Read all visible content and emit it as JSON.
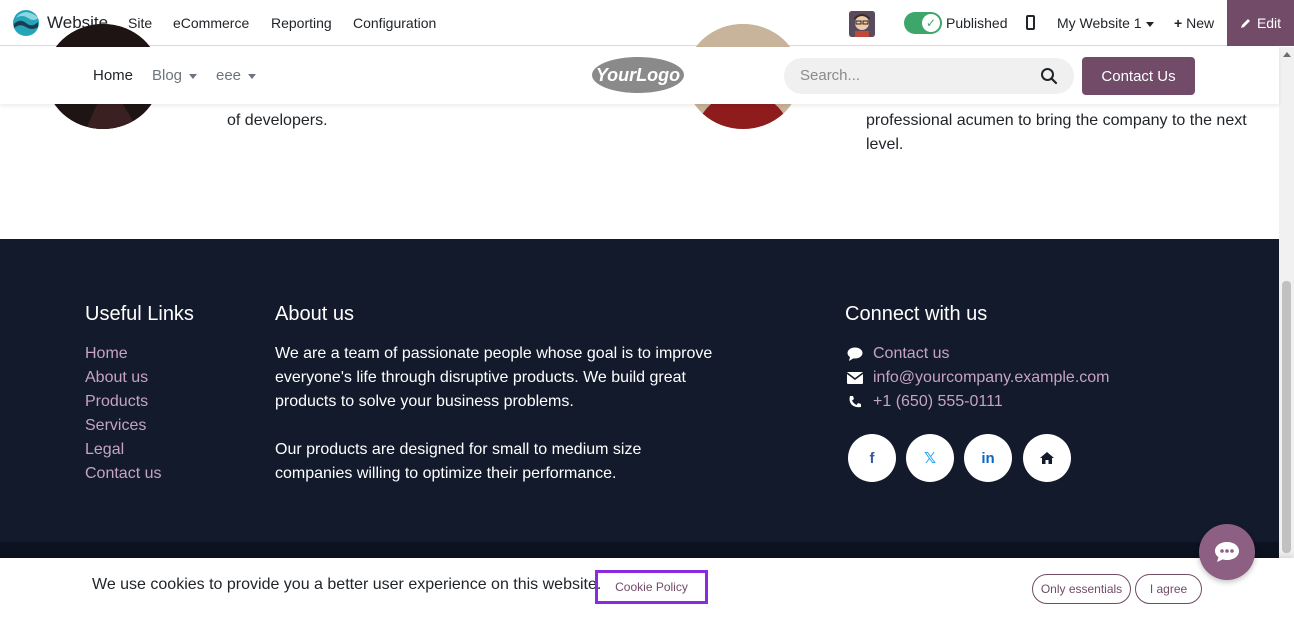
{
  "admin_bar": {
    "app_name": "Website",
    "menu": [
      "Site",
      "eCommerce",
      "Reporting",
      "Configuration"
    ],
    "published_label": "Published",
    "site_select": "My Website 1",
    "new_label": "New",
    "edit_label": "Edit"
  },
  "site_header": {
    "nav": [
      "Home",
      "Blog",
      "eee"
    ],
    "logo_text": "YourLogo",
    "search_placeholder": "Search...",
    "contact_btn": "Contact Us"
  },
  "team": {
    "left_text": "of developers.",
    "right_text_line1": "professional acumen to bring the company to the next",
    "right_text_line2": "level."
  },
  "footer": {
    "useful_links_heading": "Useful Links",
    "useful_links": [
      "Home",
      "About us",
      "Products",
      "Services",
      "Legal",
      "Contact us"
    ],
    "about_heading": "About us",
    "about_p1": "We are a team of passionate people whose goal is to improve everyone's life through disruptive products. We build great products to solve your business problems.",
    "about_p2": "Our products are designed for small to medium size companies willing to optimize their performance.",
    "connect_heading": "Connect with us",
    "contact_us": "Contact us",
    "email": "info@yourcompany.example.com",
    "phone": "+1 (650) 555-0111",
    "social_icons": [
      "facebook-icon",
      "x-twitter-icon",
      "linkedin-icon",
      "home-icon"
    ]
  },
  "cookie_bar": {
    "text": "We use cookies to provide you a better user experience on this website.",
    "policy_link": "Cookie Policy",
    "only_essentials": "Only essentials",
    "agree": "I agree"
  },
  "colors": {
    "brand": "#714b67",
    "footer_bg": "#131a2b",
    "footer_link": "#c6a4bf",
    "toggle_on": "#3ea66b"
  }
}
